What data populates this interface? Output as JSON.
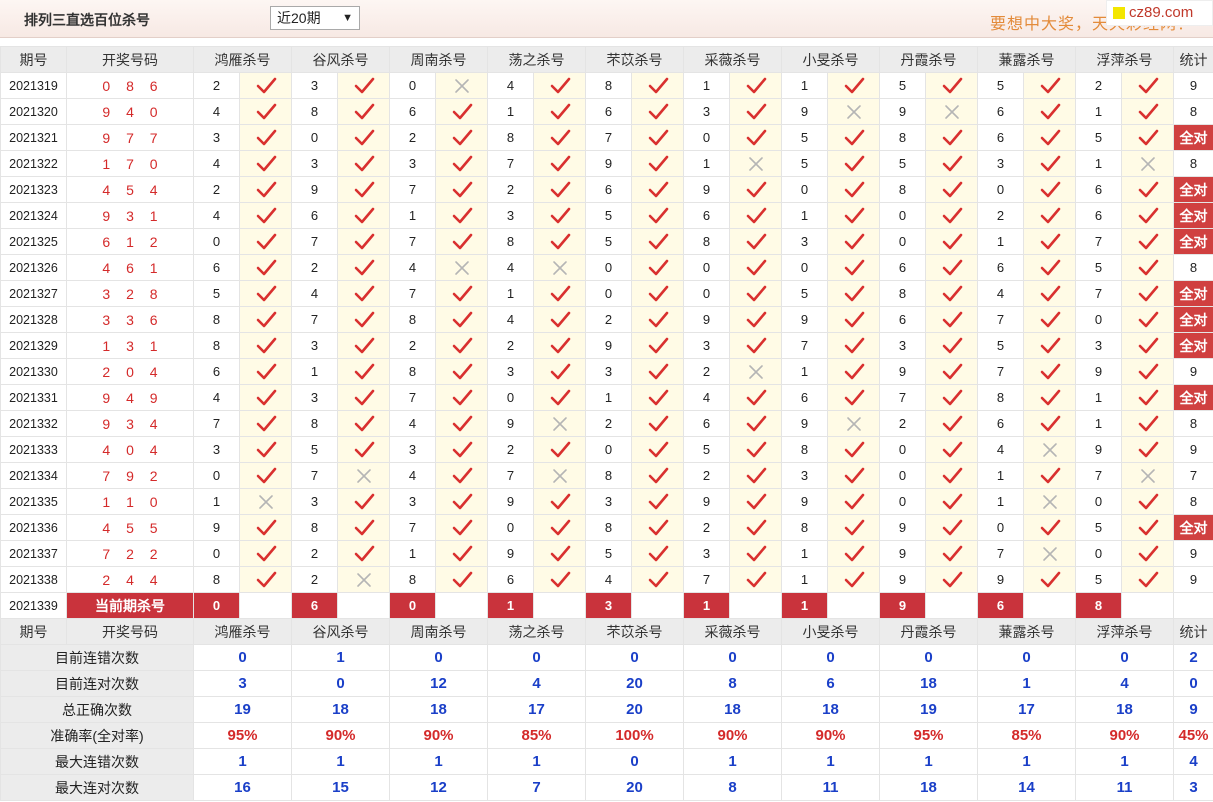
{
  "header": {
    "title": "排列三直选百位杀号",
    "period_select": "近20期",
    "slogan": "要想中大奖，天天彩经网！",
    "logo_text": "cz89.com"
  },
  "columns": {
    "period": "期号",
    "number": "开奖号码",
    "experts": [
      "鸿雁杀号",
      "谷风杀号",
      "周南杀号",
      "荡之杀号",
      "芣苡杀号",
      "采薇杀号",
      "小旻杀号",
      "丹霞杀号",
      "蒹露杀号",
      "浮萍杀号"
    ],
    "stat": "统计"
  },
  "marks": {
    "correct": "red-checkmark-icon",
    "wrong": "gray-x-icon"
  },
  "colors": {
    "accent_red": "#d04040",
    "check_red": "#d9302f",
    "stat_blue": "#1a3fc8",
    "highlight_cell": "#fffbe6"
  },
  "rows": [
    {
      "period": "2021319",
      "number": "0 8 6",
      "kills": [
        "2",
        "3",
        "0",
        "4",
        "8",
        "1",
        "1",
        "5",
        "5",
        "2"
      ],
      "ok": [
        1,
        1,
        0,
        1,
        1,
        1,
        1,
        1,
        1,
        1
      ],
      "stat": "9"
    },
    {
      "period": "2021320",
      "number": "9 4 0",
      "kills": [
        "4",
        "8",
        "6",
        "1",
        "6",
        "3",
        "9",
        "9",
        "6",
        "1"
      ],
      "ok": [
        1,
        1,
        1,
        1,
        1,
        1,
        0,
        0,
        1,
        1
      ],
      "stat": "8"
    },
    {
      "period": "2021321",
      "number": "9 7 7",
      "kills": [
        "3",
        "0",
        "2",
        "8",
        "7",
        "0",
        "5",
        "8",
        "6",
        "5"
      ],
      "ok": [
        1,
        1,
        1,
        1,
        1,
        1,
        1,
        1,
        1,
        1
      ],
      "stat": "全对"
    },
    {
      "period": "2021322",
      "number": "1 7 0",
      "kills": [
        "4",
        "3",
        "3",
        "7",
        "9",
        "1",
        "5",
        "5",
        "3",
        "1"
      ],
      "ok": [
        1,
        1,
        1,
        1,
        1,
        0,
        1,
        1,
        1,
        0
      ],
      "stat": "8"
    },
    {
      "period": "2021323",
      "number": "4 5 4",
      "kills": [
        "2",
        "9",
        "7",
        "2",
        "6",
        "9",
        "0",
        "8",
        "0",
        "6"
      ],
      "ok": [
        1,
        1,
        1,
        1,
        1,
        1,
        1,
        1,
        1,
        1
      ],
      "stat": "全对"
    },
    {
      "period": "2021324",
      "number": "9 3 1",
      "kills": [
        "4",
        "6",
        "1",
        "3",
        "5",
        "6",
        "1",
        "0",
        "2",
        "6"
      ],
      "ok": [
        1,
        1,
        1,
        1,
        1,
        1,
        1,
        1,
        1,
        1
      ],
      "stat": "全对"
    },
    {
      "period": "2021325",
      "number": "6 1 2",
      "kills": [
        "0",
        "7",
        "7",
        "8",
        "5",
        "8",
        "3",
        "0",
        "1",
        "7"
      ],
      "ok": [
        1,
        1,
        1,
        1,
        1,
        1,
        1,
        1,
        1,
        1
      ],
      "stat": "全对"
    },
    {
      "period": "2021326",
      "number": "4 6 1",
      "kills": [
        "6",
        "2",
        "4",
        "4",
        "0",
        "0",
        "0",
        "6",
        "6",
        "5"
      ],
      "ok": [
        1,
        1,
        0,
        0,
        1,
        1,
        1,
        1,
        1,
        1
      ],
      "stat": "8"
    },
    {
      "period": "2021327",
      "number": "3 2 8",
      "kills": [
        "5",
        "4",
        "7",
        "1",
        "0",
        "0",
        "5",
        "8",
        "4",
        "7"
      ],
      "ok": [
        1,
        1,
        1,
        1,
        1,
        1,
        1,
        1,
        1,
        1
      ],
      "stat": "全对"
    },
    {
      "period": "2021328",
      "number": "3 3 6",
      "kills": [
        "8",
        "7",
        "8",
        "4",
        "2",
        "9",
        "9",
        "6",
        "7",
        "0"
      ],
      "ok": [
        1,
        1,
        1,
        1,
        1,
        1,
        1,
        1,
        1,
        1
      ],
      "stat": "全对"
    },
    {
      "period": "2021329",
      "number": "1 3 1",
      "kills": [
        "8",
        "3",
        "2",
        "2",
        "9",
        "3",
        "7",
        "3",
        "5",
        "3"
      ],
      "ok": [
        1,
        1,
        1,
        1,
        1,
        1,
        1,
        1,
        1,
        1
      ],
      "stat": "全对"
    },
    {
      "period": "2021330",
      "number": "2 0 4",
      "kills": [
        "6",
        "1",
        "8",
        "3",
        "3",
        "2",
        "1",
        "9",
        "7",
        "9"
      ],
      "ok": [
        1,
        1,
        1,
        1,
        1,
        0,
        1,
        1,
        1,
        1
      ],
      "stat": "9"
    },
    {
      "period": "2021331",
      "number": "9 4 9",
      "kills": [
        "4",
        "3",
        "7",
        "0",
        "1",
        "4",
        "6",
        "7",
        "8",
        "1"
      ],
      "ok": [
        1,
        1,
        1,
        1,
        1,
        1,
        1,
        1,
        1,
        1
      ],
      "stat": "全对"
    },
    {
      "period": "2021332",
      "number": "9 3 4",
      "kills": [
        "7",
        "8",
        "4",
        "9",
        "2",
        "6",
        "9",
        "2",
        "6",
        "1"
      ],
      "ok": [
        1,
        1,
        1,
        0,
        1,
        1,
        0,
        1,
        1,
        1
      ],
      "stat": "8"
    },
    {
      "period": "2021333",
      "number": "4 0 4",
      "kills": [
        "3",
        "5",
        "3",
        "2",
        "0",
        "5",
        "8",
        "0",
        "4",
        "9"
      ],
      "ok": [
        1,
        1,
        1,
        1,
        1,
        1,
        1,
        1,
        0,
        1
      ],
      "stat": "9"
    },
    {
      "period": "2021334",
      "number": "7 9 2",
      "kills": [
        "0",
        "7",
        "4",
        "7",
        "8",
        "2",
        "3",
        "0",
        "1",
        "7"
      ],
      "ok": [
        1,
        0,
        1,
        0,
        1,
        1,
        1,
        1,
        1,
        0
      ],
      "stat": "7"
    },
    {
      "period": "2021335",
      "number": "1 1 0",
      "kills": [
        "1",
        "3",
        "3",
        "9",
        "3",
        "9",
        "9",
        "0",
        "1",
        "0"
      ],
      "ok": [
        0,
        1,
        1,
        1,
        1,
        1,
        1,
        1,
        0,
        1
      ],
      "stat": "8"
    },
    {
      "period": "2021336",
      "number": "4 5 5",
      "kills": [
        "9",
        "8",
        "7",
        "0",
        "8",
        "2",
        "8",
        "9",
        "0",
        "5"
      ],
      "ok": [
        1,
        1,
        1,
        1,
        1,
        1,
        1,
        1,
        1,
        1
      ],
      "stat": "全对"
    },
    {
      "period": "2021337",
      "number": "7 2 2",
      "kills": [
        "0",
        "2",
        "1",
        "9",
        "5",
        "3",
        "1",
        "9",
        "7",
        "0"
      ],
      "ok": [
        1,
        1,
        1,
        1,
        1,
        1,
        1,
        1,
        0,
        1
      ],
      "stat": "9"
    },
    {
      "period": "2021338",
      "number": "2 4 4",
      "kills": [
        "8",
        "2",
        "8",
        "6",
        "4",
        "7",
        "1",
        "9",
        "9",
        "5"
      ],
      "ok": [
        1,
        0,
        1,
        1,
        1,
        1,
        1,
        1,
        1,
        1
      ],
      "stat": "9"
    }
  ],
  "current": {
    "period": "2021339",
    "label": "当前期杀号",
    "kills": [
      "0",
      "6",
      "0",
      "1",
      "3",
      "1",
      "1",
      "9",
      "6",
      "8"
    ]
  },
  "summary": [
    {
      "label": "目前连错次数",
      "values": [
        "0",
        "1",
        "0",
        "0",
        "0",
        "0",
        "0",
        "0",
        "0",
        "0"
      ],
      "stat": "2",
      "red": false
    },
    {
      "label": "目前连对次数",
      "values": [
        "3",
        "0",
        "12",
        "4",
        "20",
        "8",
        "6",
        "18",
        "1",
        "4"
      ],
      "stat": "0",
      "red": false
    },
    {
      "label": "总正确次数",
      "values": [
        "19",
        "18",
        "18",
        "17",
        "20",
        "18",
        "18",
        "19",
        "17",
        "18"
      ],
      "stat": "9",
      "red": false
    },
    {
      "label": "准确率(全对率)",
      "values": [
        "95%",
        "90%",
        "90%",
        "85%",
        "100%",
        "90%",
        "90%",
        "95%",
        "85%",
        "90%"
      ],
      "stat": "45%",
      "red": true
    },
    {
      "label": "最大连错次数",
      "values": [
        "1",
        "1",
        "1",
        "1",
        "0",
        "1",
        "1",
        "1",
        "1",
        "1"
      ],
      "stat": "4",
      "red": false
    },
    {
      "label": "最大连对次数",
      "values": [
        "16",
        "15",
        "12",
        "7",
        "20",
        "8",
        "11",
        "18",
        "14",
        "11"
      ],
      "stat": "3",
      "red": false
    }
  ]
}
